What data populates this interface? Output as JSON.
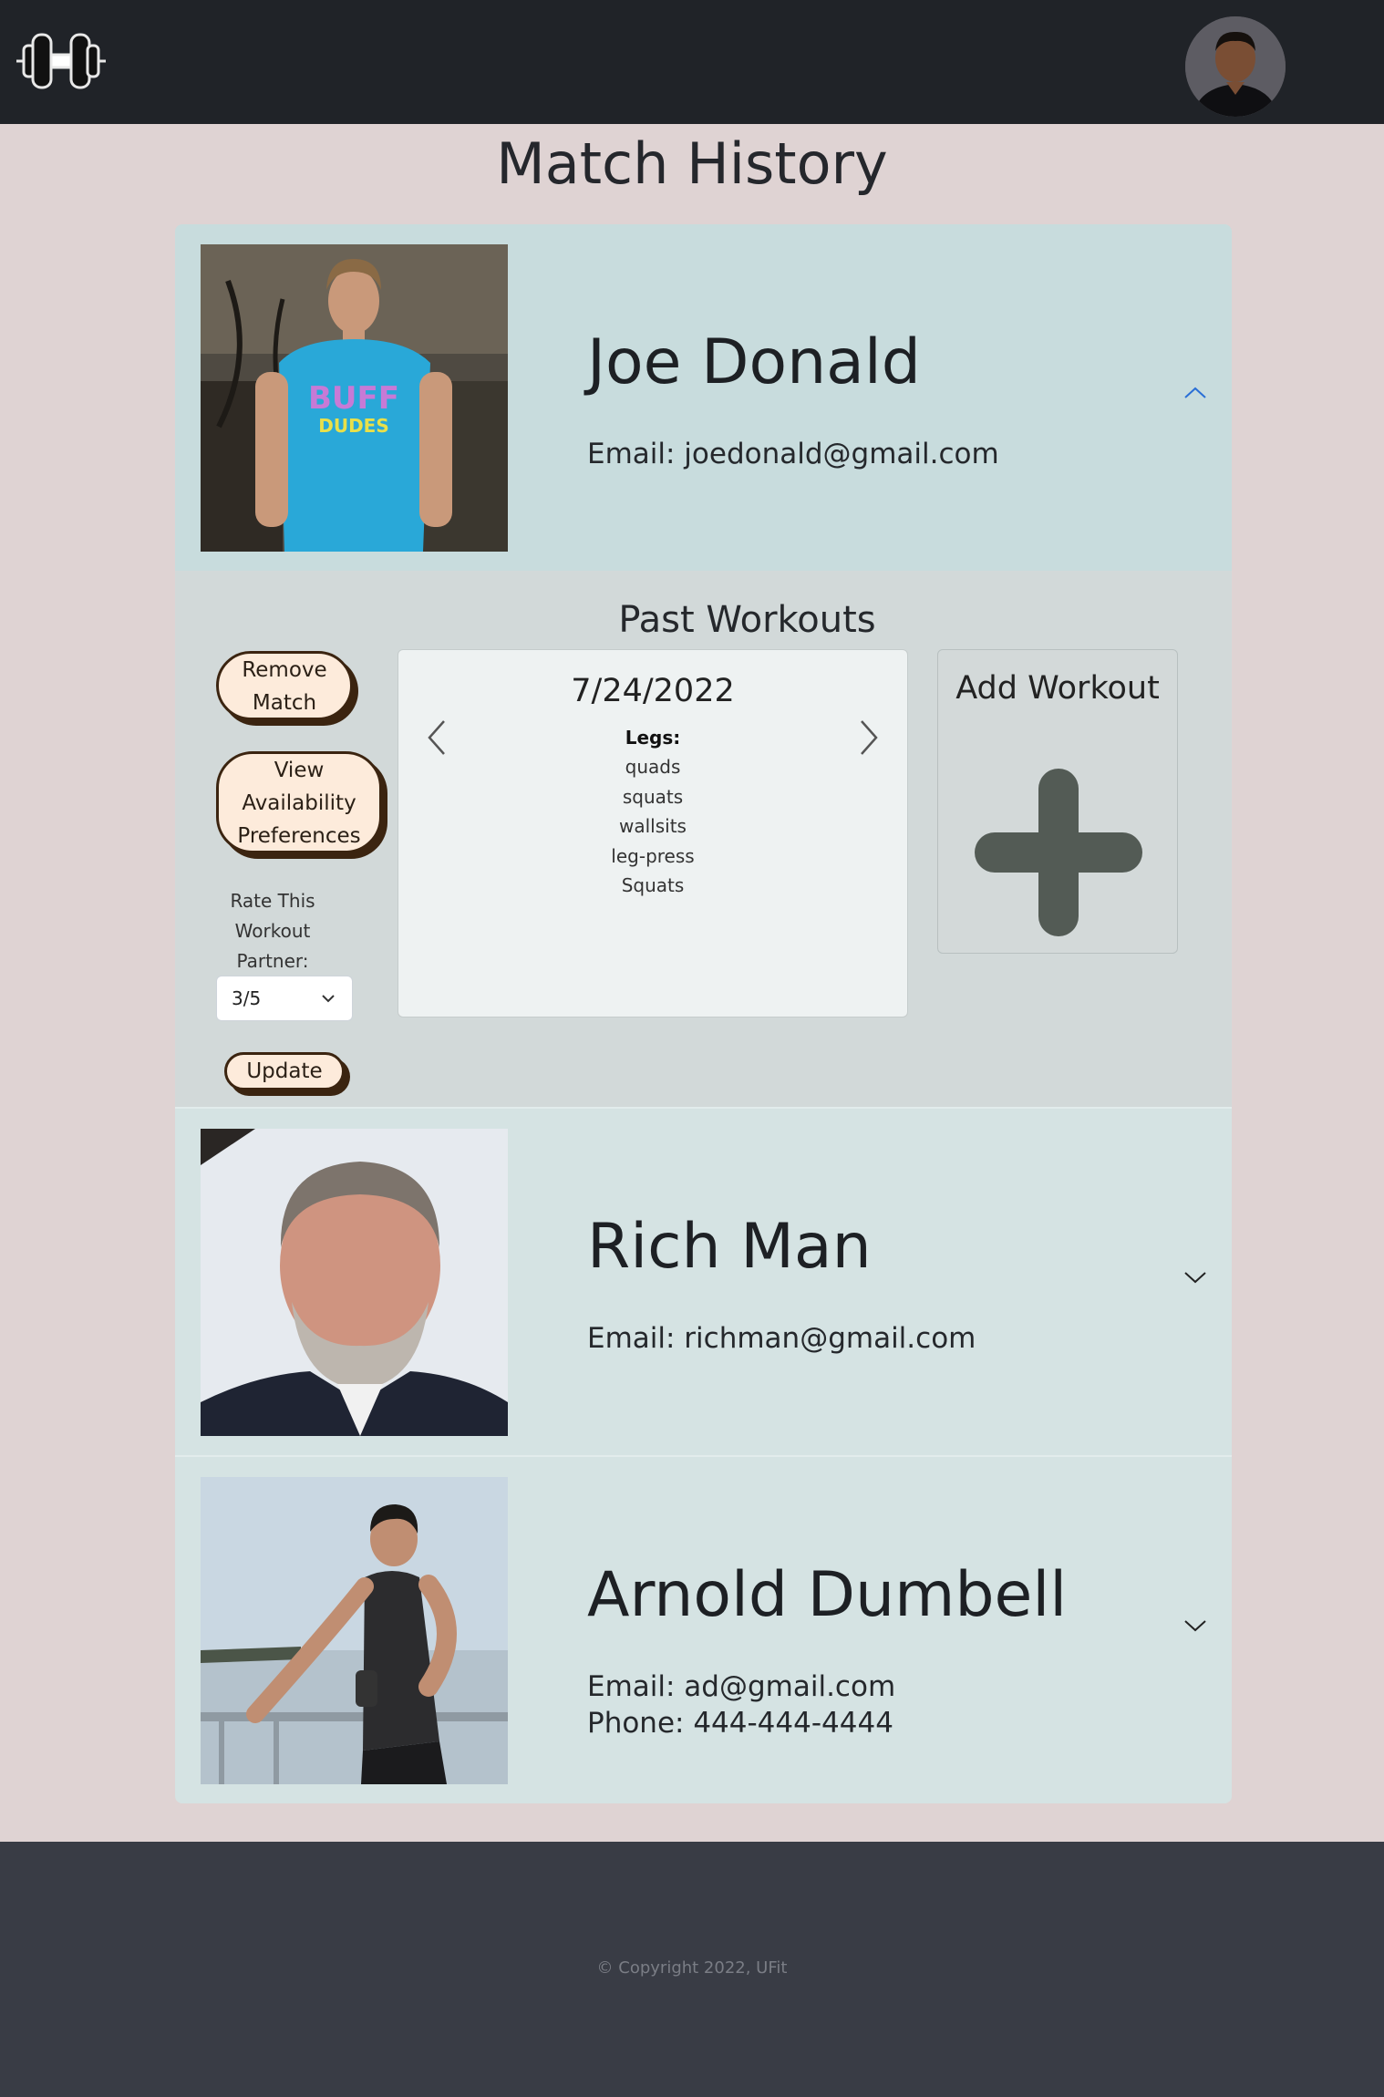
{
  "header": {
    "logo_icon": "dumbbell-icon",
    "avatar_icon": "user-avatar"
  },
  "page": {
    "title": "Match History"
  },
  "matches": [
    {
      "name": "Joe Donald",
      "email": "Email: joedonald@gmail.com",
      "expanded": true,
      "details": {
        "section_title": "Past Workouts",
        "remove_button": "Remove Match",
        "availability_button": "View Availability Preferences",
        "rate_label": "Rate This Workout Partner:",
        "rating_selected": "3/5",
        "update_button": "Update",
        "workout": {
          "date": "7/24/2022",
          "group": "Legs:",
          "exercises": [
            "quads",
            "squats",
            "wallsits",
            "leg-press",
            "Squats"
          ]
        },
        "add_workout_label": "Add Workout"
      }
    },
    {
      "name": "Rich Man",
      "email": "Email: richman@gmail.com",
      "expanded": false
    },
    {
      "name": "Arnold Dumbell",
      "email": "Email: ad@gmail.com",
      "phone": "Phone: 444-444-4444",
      "expanded": false
    }
  ],
  "footer": {
    "copyright": "© Copyright 2022, UFit"
  },
  "colors": {
    "header_bg": "#202328",
    "page_bg": "#dfd3d3",
    "open_header_bg": "#c8dcdd",
    "closed_header_bg": "#d5e3e3",
    "body_bg": "#d2d9d9",
    "pill_bg": "#fdebdb",
    "footer_bg": "#393c45",
    "chevron_open": "#2a6fd6"
  }
}
